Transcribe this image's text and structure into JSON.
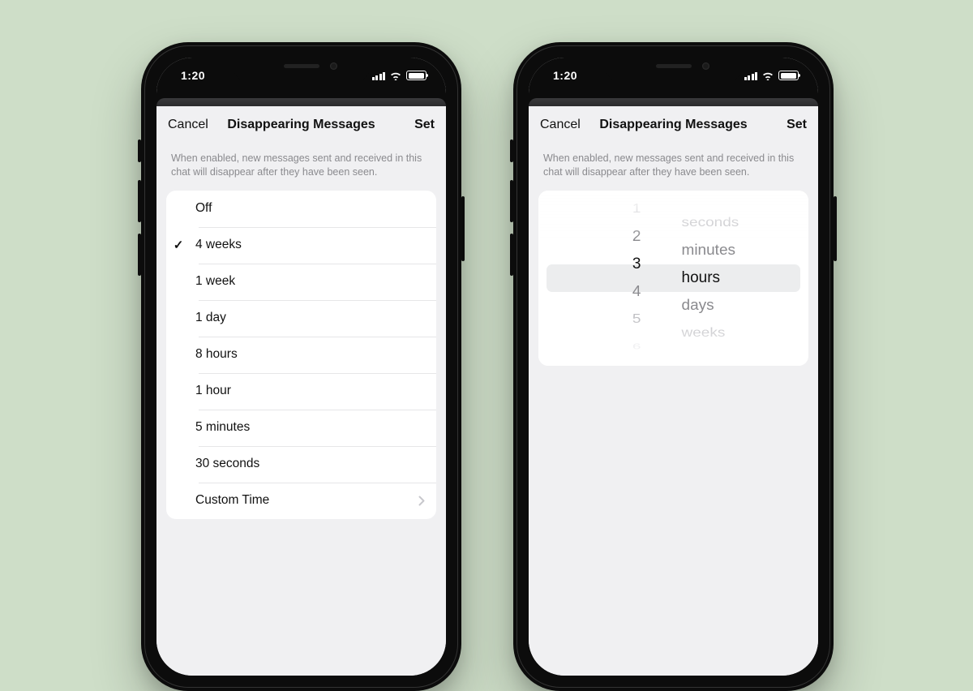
{
  "status": {
    "time": "1:20"
  },
  "modal": {
    "cancel": "Cancel",
    "title": "Disappearing Messages",
    "set": "Set",
    "caption": "When enabled, new messages sent and received in this chat will disappear after they have been seen."
  },
  "options": {
    "selected_index": 1,
    "items": [
      {
        "label": "Off"
      },
      {
        "label": "4 weeks"
      },
      {
        "label": "1 week"
      },
      {
        "label": "1 day"
      },
      {
        "label": "8 hours"
      },
      {
        "label": "1 hour"
      },
      {
        "label": "5 minutes"
      },
      {
        "label": "30 seconds"
      },
      {
        "label": "Custom Time",
        "disclosure": true
      }
    ]
  },
  "picker": {
    "numbers": [
      "1",
      "2",
      "3",
      "4",
      "5",
      "6"
    ],
    "units": [
      "seconds",
      "minutes",
      "hours",
      "days",
      "weeks"
    ],
    "selected_number": "3",
    "selected_unit": "hours"
  }
}
